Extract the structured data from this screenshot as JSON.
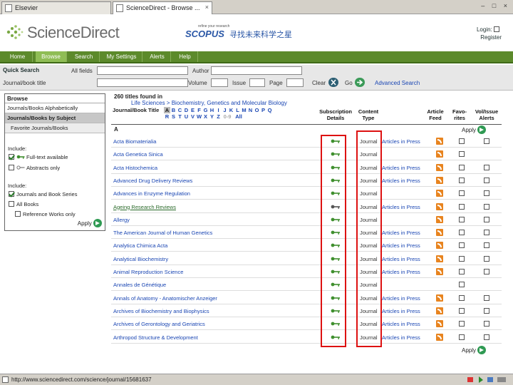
{
  "browser": {
    "tabs": [
      {
        "label": "Elsevier",
        "active": false
      },
      {
        "label": "ScienceDirect - Browse ...",
        "active": true
      }
    ],
    "window_controls": "– □ ×"
  },
  "header": {
    "logo_text": "ScienceDirect",
    "scopus_tagline": "refine your research",
    "scopus_name": "SCOPUS",
    "scopus_cn": "寻找未来科学之星",
    "login": "Login:",
    "register": "Register"
  },
  "nav": {
    "items": [
      {
        "label": "Home",
        "active": false
      },
      {
        "label": "Browse",
        "active": true
      },
      {
        "label": "Search",
        "active": false
      },
      {
        "label": "My Settings",
        "active": false
      },
      {
        "label": "Alerts",
        "active": false
      },
      {
        "label": "Help",
        "active": false
      }
    ]
  },
  "quick_search": {
    "title": "Quick Search",
    "all_fields": "All fields",
    "author": "Author",
    "journal_label": "Journal/book title",
    "volume": "Volume",
    "issue": "Issue",
    "page": "Page",
    "clear": "Clear",
    "go": "Go",
    "advanced": "Advanced Search"
  },
  "sidebar": {
    "head": "Browse",
    "links": [
      {
        "label": "Journals/Books Alphabetically",
        "state": "link"
      },
      {
        "label": "Journals/Books by Subject",
        "state": "current"
      },
      {
        "label": "Favorite Journals/Books",
        "state": "sub"
      }
    ],
    "include1": "Include:",
    "full_text": "Full-text available",
    "abstracts": "Abstracts only",
    "include2": "Include:",
    "journals_series": "Journals and Book Series",
    "all_books": "All Books",
    "ref_works": "Reference Works only",
    "apply": "Apply"
  },
  "results": {
    "found": "260 titles found in",
    "breadcrumb": "Life Sciences > Biochemistry, Genetics and Molecular Biology",
    "col_title": "Journal/Book Title",
    "col_subscription": "Subscription Details",
    "col_content": "Content Type",
    "col_feed": "Article Feed",
    "col_favorites": "Favo-rites",
    "col_alerts": "Vol/Issue Alerts",
    "letters": [
      "A",
      "B",
      "C",
      "D",
      "E",
      "F",
      "G",
      "H",
      "I",
      "J",
      "K",
      "L",
      "M",
      "N",
      "O",
      "P",
      "Q",
      "R",
      "S",
      "T",
      "U",
      "V",
      "W",
      "X",
      "Y",
      "Z",
      "0-9",
      "All"
    ],
    "current_letter": "A",
    "apply": "Apply",
    "rows": [
      {
        "title": "Acta Biomaterialia",
        "content": "Journal",
        "aip": "Articles in Press",
        "feed": true,
        "alert": true
      },
      {
        "title": "Acta Genetica Sinica",
        "content": "Journal",
        "aip": "",
        "feed": true,
        "alert": false
      },
      {
        "title": "Acta Histochemica",
        "content": "Journal",
        "aip": "Articles in Press",
        "feed": true,
        "alert": true
      },
      {
        "title": "Advanced Drug Delivery Reviews",
        "content": "Journal",
        "aip": "Articles in Press",
        "feed": true,
        "alert": true
      },
      {
        "title": "Advances in Enzyme Regulation",
        "content": "Journal",
        "aip": "",
        "feed": true,
        "alert": true
      },
      {
        "title": "Ageing Research Reviews",
        "content": "Journal",
        "aip": "Articles in Press",
        "feed": true,
        "alert": true,
        "visited": true
      },
      {
        "title": "Allergy",
        "content": "Journal",
        "aip": "",
        "feed": true,
        "alert": true
      },
      {
        "title": "The American Journal of Human Genetics",
        "content": "Journal",
        "aip": "Articles in Press",
        "feed": true,
        "alert": true
      },
      {
        "title": "Analytica Chimica Acta",
        "content": "Journal",
        "aip": "Articles in Press",
        "feed": true,
        "alert": true
      },
      {
        "title": "Analytical Biochemistry",
        "content": "Journal",
        "aip": "Articles in Press",
        "feed": true,
        "alert": true
      },
      {
        "title": "Animal Reproduction Science",
        "content": "Journal",
        "aip": "Articles in Press",
        "feed": true,
        "alert": true
      },
      {
        "title": "Annales de Génétique",
        "content": "Journal",
        "aip": "",
        "feed": false,
        "alert": false
      },
      {
        "title": "Annals of Anatomy - Anatomischer Anzeiger",
        "content": "Journal",
        "aip": "Articles in Press",
        "feed": true,
        "alert": true
      },
      {
        "title": "Archives of Biochemistry and Biophysics",
        "content": "Journal",
        "aip": "Articles in Press",
        "feed": true,
        "alert": true
      },
      {
        "title": "Archives of Gerontology and Geriatrics",
        "content": "Journal",
        "aip": "Articles in Press",
        "feed": true,
        "alert": true
      },
      {
        "title": "Arthropod Structure & Development",
        "content": "Journal",
        "aip": "Articles in Press",
        "feed": true,
        "alert": true
      }
    ]
  },
  "status": {
    "url": "http://www.sciencedirect.com/science/journal/15681637"
  },
  "colors": {
    "nav_green": "#5c8a2b",
    "nav_active": "#8fbd55",
    "link_blue": "#1a46b3",
    "highlight_red": "#d11111",
    "rss_orange": "#e8841f"
  }
}
